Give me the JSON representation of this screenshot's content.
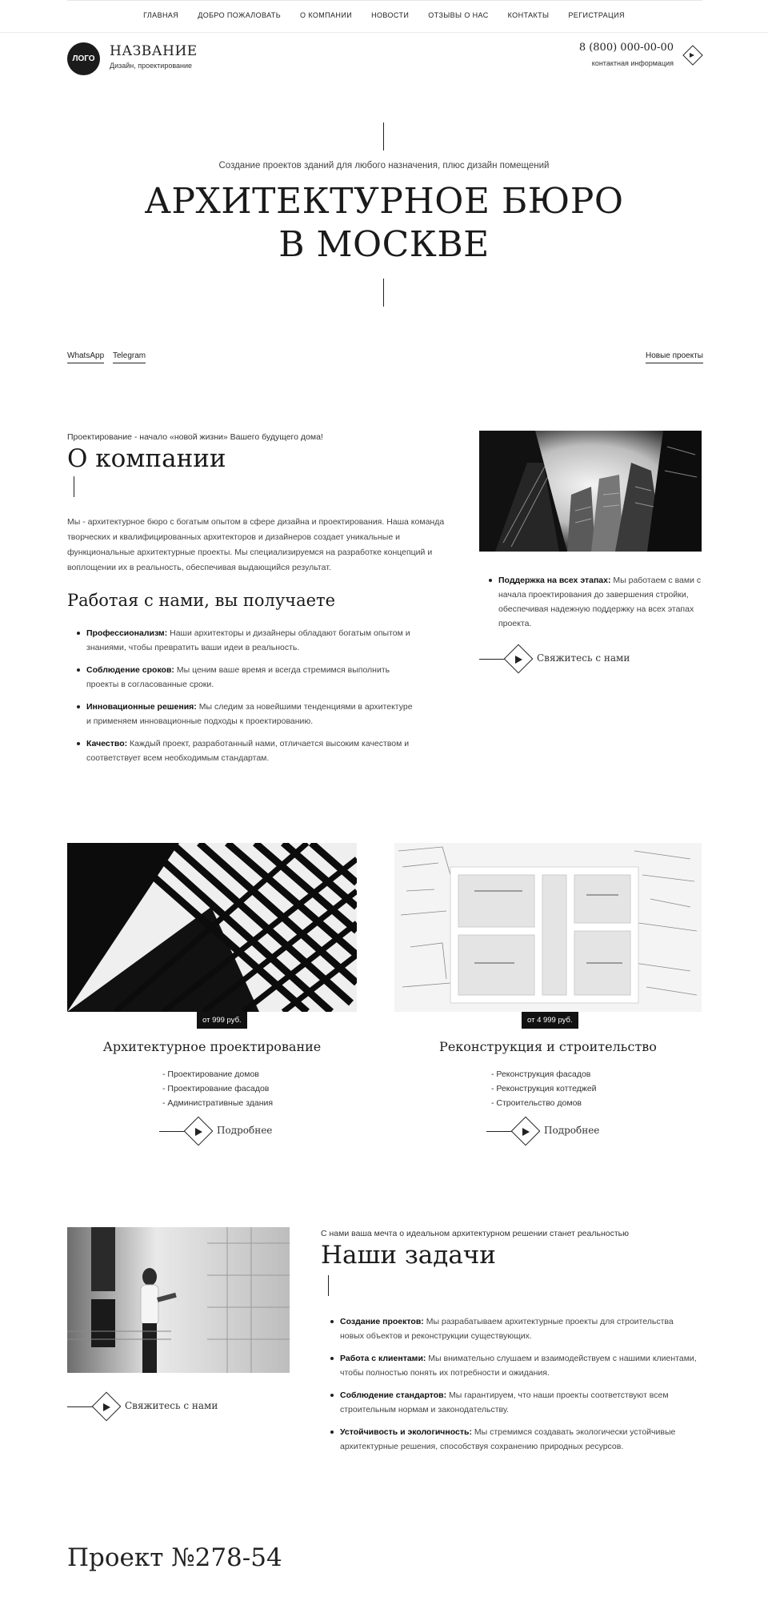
{
  "nav": {
    "items": [
      "ГЛАВНАЯ",
      "ДОБРО ПОЖАЛОВАТЬ",
      "О КОМПАНИИ",
      "НОВОСТИ",
      "ОТЗЫВЫ О НАС",
      "КОНТАКТЫ",
      "РЕГИСТРАЦИЯ"
    ]
  },
  "header": {
    "logo": "ЛОГО",
    "name": "НАЗВАНИЕ",
    "subtitle": "Дизайн, проектирование",
    "phone": "8 (800) 000-00-00",
    "contact_label": "контактная информация"
  },
  "hero": {
    "subtitle": "Создание проектов зданий  для любого назначения, плюс дизайн помещений",
    "title_line1": "АРХИТЕКТУРНОЕ БЮРО",
    "title_line2": "В МОСКВЕ"
  },
  "social": {
    "whatsapp": "WhatsApp",
    "telegram": "Telegram",
    "new_projects": "Новые проекты"
  },
  "about": {
    "kicker": "Проектирование - начало «новой жизни» Вашего будущего дома!",
    "title": "О компании",
    "text": "Мы - архитектурное бюро с богатым опытом в сфере дизайна и проектирования. Наша команда творческих и квалифицированных архитекторов и дизайнеров создает уникальные и функциональные архитектурные проекты. Мы специализируемся на разработке концепций и воплощении их в реальность, обеспечивая выдающийся результат.",
    "benefits_title": "Работая с нами, вы получаете",
    "benefits": [
      {
        "label": "Профессионализм:",
        "text": " Наши архитекторы и дизайнеры обладают богатым опытом и знаниями, чтобы превратить ваши идеи в реальность."
      },
      {
        "label": "Соблюдение сроков:",
        "text": " Мы ценим ваше время и всегда стремимся выполнить проекты в согласованные сроки."
      },
      {
        "label": "Инновационные решения:",
        "text": " Мы следим за новейшими тенденциями в архитектуре и применяем инновационные подходы к проектированию."
      },
      {
        "label": "Качество:",
        "text": " Каждый проект, разработанный нами, отличается высоким качеством и соответствует всем необходимым стандартам."
      }
    ],
    "support": {
      "label": "Поддержка на всех этапах:",
      "text": " Мы работаем с вами с начала проектирования до завершения стройки, обеспечивая надежную поддержку на всех этапах проекта."
    },
    "cta": "Свяжитесь с нами"
  },
  "services": [
    {
      "price": "от 999 руб.",
      "title": "Архитектурное проектирование",
      "items": [
        "- Проектирование домов",
        "- Проектирование фасадов",
        "- Административные здания"
      ],
      "more": "Подробнее"
    },
    {
      "price": "от 4 999 руб.",
      "title": "Реконструкция и строительство",
      "items": [
        "- Реконструкция фасадов",
        "- Реконструкция коттеджей",
        "- Строительство домов"
      ],
      "more": "Подробнее"
    }
  ],
  "tasks": {
    "kicker": "С нами ваша мечта о идеальном архитектурном решении станет реальностью",
    "title": "Наши задачи",
    "items": [
      {
        "label": "Создание проектов:",
        "text": " Мы разрабатываем архитектурные проекты для строительства новых объектов и реконструкции существующих."
      },
      {
        "label": "Работа с клиентами:",
        "text": " Мы внимательно слушаем и взаимодействуем с нашими клиентами, чтобы полностью понять их потребности и ожидания."
      },
      {
        "label": "Соблюдение стандартов:",
        "text": " Мы гарантируем, что наши проекты соответствуют всем строительным нормам и законодательству."
      },
      {
        "label": "Устойчивость и экологичность:",
        "text": " Мы стремимся создавать экологически устойчивые архитектурные решения, способствуя сохранению природных ресурсов."
      }
    ],
    "cta": "Свяжитесь с нами"
  },
  "project": {
    "title": "Проект №278-54"
  }
}
